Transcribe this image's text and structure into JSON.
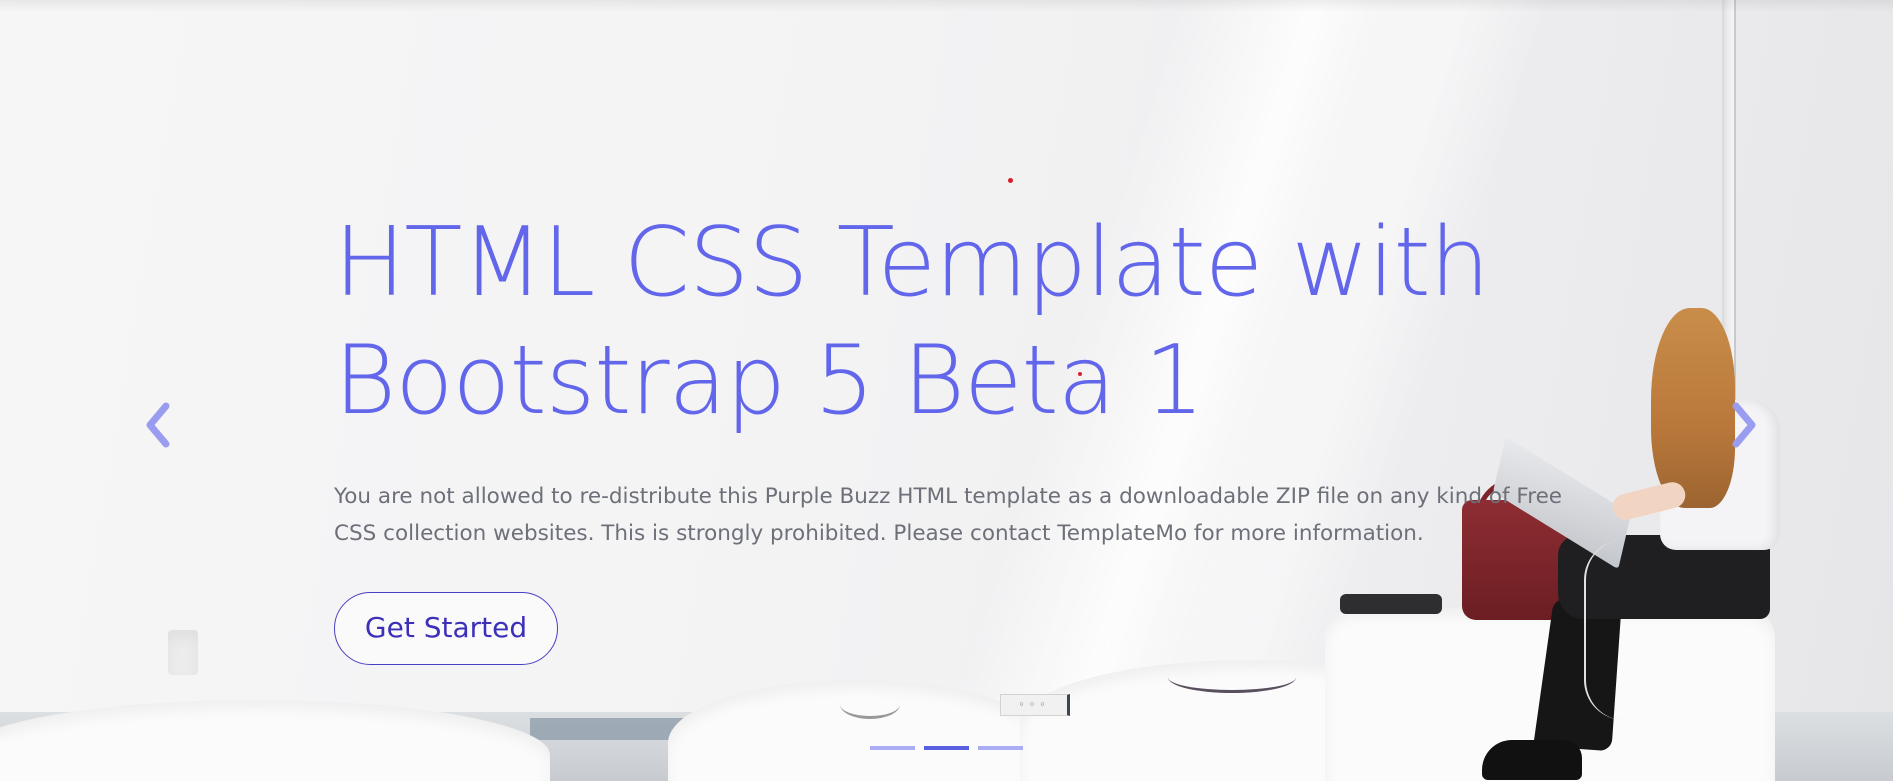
{
  "hero": {
    "title_line1": "HTML CSS Template with",
    "title_line2": "Bootstrap 5 Beta 1",
    "description": "You are not allowed to re-distribute this Purple Buzz HTML template as a downloadable ZIP file on any kind of Free CSS collection websites. This is strongly prohibited. Please contact TemplateMo for more information.",
    "cta_label": "Get Started"
  },
  "carousel": {
    "prev_icon": "chevron-left-icon",
    "next_icon": "chevron-right-icon",
    "slide_count": 3,
    "active_slide": 2
  },
  "colors": {
    "title": "#6266ea",
    "text": "#6d7079",
    "button_border": "#4a3fc4",
    "indicator": "#8f93ee",
    "indicator_active": "#5a5fe0"
  }
}
